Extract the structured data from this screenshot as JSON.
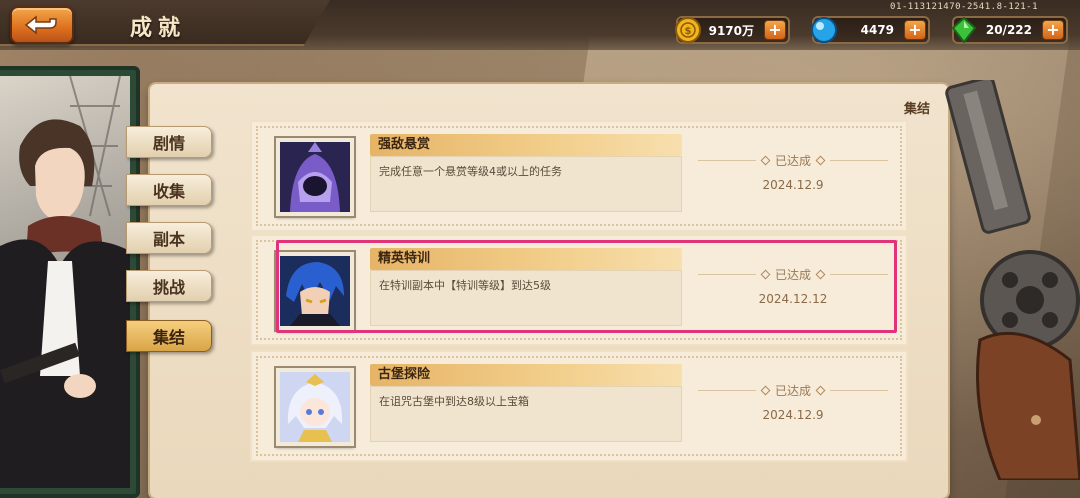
{
  "header": {
    "title": "成就",
    "version": "01-113121470-2541.8-121-1"
  },
  "resources": {
    "gold": {
      "value": "9170万",
      "icon": "gold-coin-icon"
    },
    "gems": {
      "value": "4479",
      "icon": "blue-gem-icon"
    },
    "stamina": {
      "value": "20/222",
      "icon": "green-crystal-icon"
    }
  },
  "panel": {
    "label": "集结"
  },
  "tabs": [
    {
      "label": "剧情"
    },
    {
      "label": "收集"
    },
    {
      "label": "副本"
    },
    {
      "label": "挑战"
    },
    {
      "label": "集结",
      "active": true
    }
  ],
  "achievements": [
    {
      "title": "强敌悬赏",
      "description": "完成任意一个悬赏等级4或以上的任务",
      "status": "已达成",
      "date": "2024.12.9"
    },
    {
      "title": "精英特训",
      "description": "在特训副本中【特训等级】到达5级",
      "status": "已达成",
      "date": "2024.12.12",
      "highlighted": true
    },
    {
      "title": "古堡探险",
      "description": "在诅咒古堡中到达8级以上宝箱",
      "status": "已达成",
      "date": "2024.12.9"
    }
  ],
  "colors": {
    "accent_orange": "#dc6f1e",
    "highlight_pink": "#e0337a",
    "tab_active": "#d9a448"
  }
}
